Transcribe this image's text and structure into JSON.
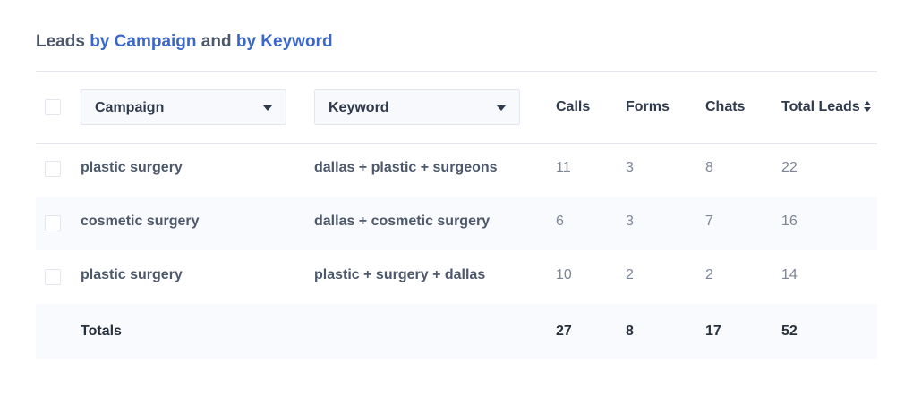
{
  "title": {
    "part1": "Leads ",
    "part2": "by Campaign",
    "part3": " and ",
    "part4": "by Keyword"
  },
  "header": {
    "campaign_filter": "Campaign",
    "keyword_filter": "Keyword",
    "columns": {
      "calls": "Calls",
      "forms": "Forms",
      "chats": "Chats",
      "total_leads": "Total Leads"
    }
  },
  "rows": [
    {
      "campaign": "plastic surgery",
      "keyword": "dallas + plastic + surgeons",
      "calls": "11",
      "forms": "3",
      "chats": "8",
      "total": "22"
    },
    {
      "campaign": "cosmetic surgery",
      "keyword": "dallas + cosmetic surgery",
      "calls": "6",
      "forms": "3",
      "chats": "7",
      "total": "16"
    },
    {
      "campaign": "plastic surgery",
      "keyword": "plastic + surgery + dallas",
      "calls": "10",
      "forms": "2",
      "chats": "2",
      "total": "14"
    }
  ],
  "totals": {
    "label": "Totals",
    "calls": "27",
    "forms": "8",
    "chats": "17",
    "total": "52"
  },
  "colors": {
    "accent": "#3b67c9",
    "alt_row": "#f8fafd",
    "divider": "#e4e8ee"
  },
  "icons": {
    "dropdown": "chevron-down-icon",
    "sort": "sort-icon"
  }
}
